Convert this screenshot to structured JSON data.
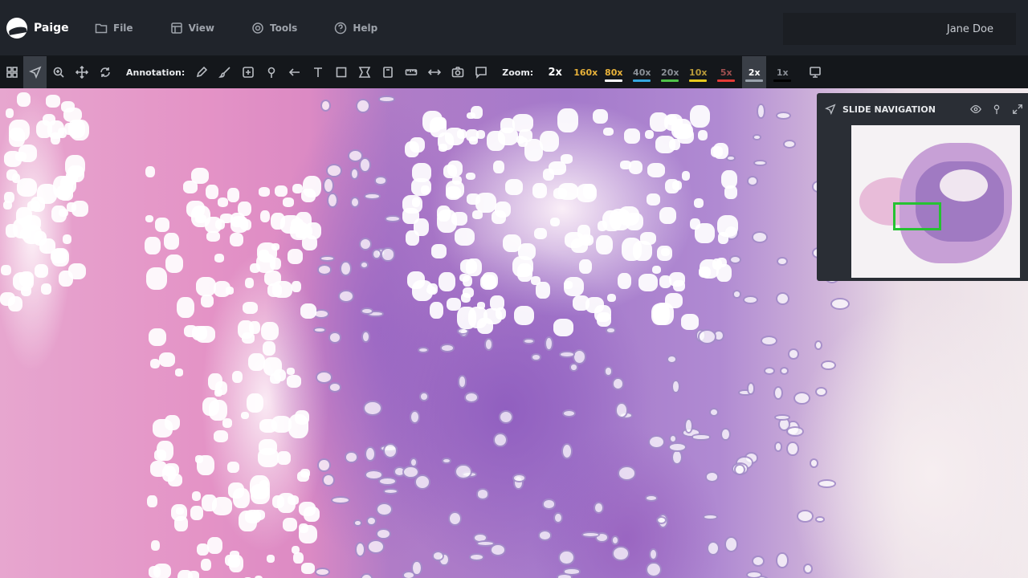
{
  "app": {
    "name": "Paige",
    "user": "Jane Doe"
  },
  "menu": [
    {
      "label": "File",
      "icon": "folder-icon"
    },
    {
      "label": "View",
      "icon": "layout-icon"
    },
    {
      "label": "Tools",
      "icon": "gear-icon"
    },
    {
      "label": "Help",
      "icon": "help-icon"
    }
  ],
  "toolbar": {
    "annotation_label": "Annotation:",
    "zoom_label": "Zoom:",
    "zoom_current": "2x",
    "zoom_options": [
      {
        "label": "160x",
        "color": "#e8b23a"
      },
      {
        "label": "80x",
        "color": "#ffffff"
      },
      {
        "label": "40x",
        "color": "#35a7e0"
      },
      {
        "label": "20x",
        "color": "#4fc24a"
      },
      {
        "label": "10x",
        "color": "#e6c81c"
      },
      {
        "label": "5x",
        "color": "#e33a36"
      },
      {
        "label": "2x",
        "color": "#9aa3ad"
      },
      {
        "label": "1x",
        "color": "#000000"
      }
    ],
    "selected_zoom": "2x"
  },
  "navigation": {
    "title": "SLIDE NAVIGATION"
  },
  "colors": {
    "topbar": "#20242b",
    "toolbar": "#14171b",
    "viewport_box": "#26c232"
  }
}
